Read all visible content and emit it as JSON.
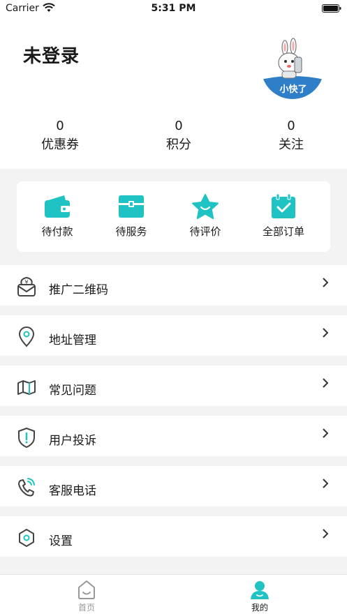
{
  "status_bar": {
    "carrier": "Carrier",
    "time": "5:31 PM"
  },
  "header": {
    "login_title": "未登录",
    "avatar_text": "小快了"
  },
  "stats": [
    {
      "value": "0",
      "label": "优惠券"
    },
    {
      "value": "0",
      "label": "积分"
    },
    {
      "value": "0",
      "label": "关注"
    }
  ],
  "orders": [
    {
      "label": "待付款",
      "icon": "wallet-icon"
    },
    {
      "label": "待服务",
      "icon": "toolbox-icon"
    },
    {
      "label": "待评价",
      "icon": "star-icon"
    },
    {
      "label": "全部订单",
      "icon": "clipboard-check-icon"
    }
  ],
  "menu": [
    {
      "label": "推广二维码",
      "icon": "money-bag-icon"
    },
    {
      "label": "地址管理",
      "icon": "location-pin-icon"
    },
    {
      "label": "常见问题",
      "icon": "map-icon"
    },
    {
      "label": "用户投诉",
      "icon": "shield-alert-icon"
    },
    {
      "label": "客服电话",
      "icon": "phone-icon"
    },
    {
      "label": "设置",
      "icon": "settings-hexagon-icon"
    }
  ],
  "tabs": [
    {
      "label": "首页",
      "icon": "home-icon",
      "active": false
    },
    {
      "label": "我的",
      "icon": "user-icon",
      "active": true
    }
  ],
  "colors": {
    "accent": "#1fc3c3",
    "icon_gray": "#444444",
    "tab_inactive": "#999999",
    "background": "#f3f3f3"
  }
}
